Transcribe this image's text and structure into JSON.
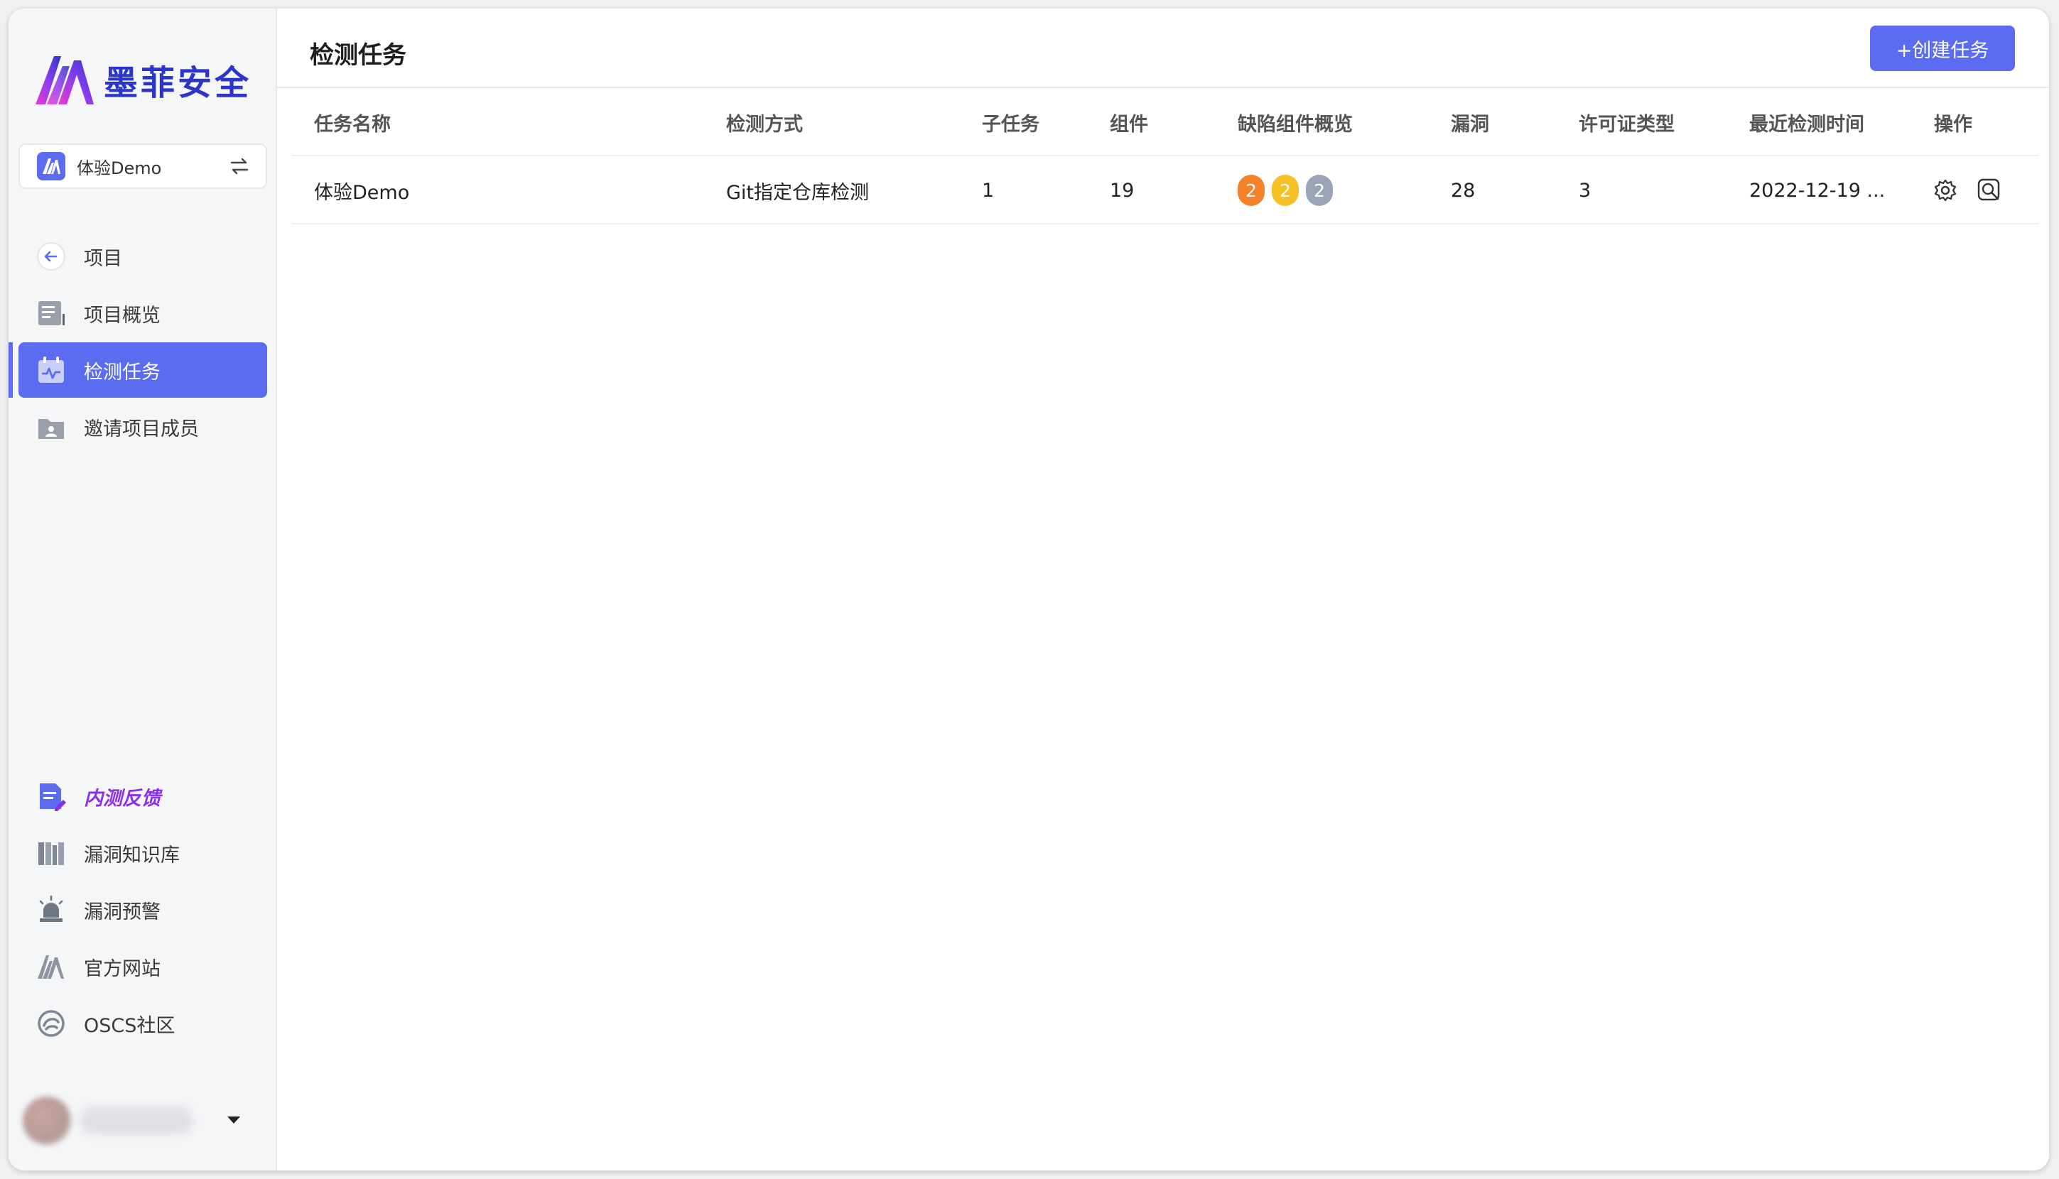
{
  "app": {
    "brand_name": "墨菲安全",
    "brand_color": "#2b35c9",
    "accent_color": "#5b6cf0"
  },
  "project_select": {
    "name": "体验Demo",
    "icon": "project-logo-icon",
    "switch_icon": "swap-icon"
  },
  "sidebar": {
    "items": [
      {
        "label": "项目",
        "icon": "back-arrow-icon",
        "active": false
      },
      {
        "label": "项目概览",
        "icon": "overview-icon",
        "active": false
      },
      {
        "label": "检测任务",
        "icon": "task-calendar-icon",
        "active": true
      },
      {
        "label": "邀请项目成员",
        "icon": "invite-member-icon",
        "active": false
      }
    ],
    "bottom_items": [
      {
        "label": "内测反馈",
        "icon": "feedback-icon",
        "style": "highlight"
      },
      {
        "label": "漏洞知识库",
        "icon": "knowledge-base-icon"
      },
      {
        "label": "漏洞预警",
        "icon": "alarm-icon"
      },
      {
        "label": "官方网站",
        "icon": "brand-logo-icon"
      },
      {
        "label": "OSCS社区",
        "icon": "community-icon"
      }
    ]
  },
  "header": {
    "title": "检测任务",
    "create_button": "+创建任务"
  },
  "table": {
    "columns": [
      "任务名称",
      "检测方式",
      "子任务",
      "组件",
      "缺陷组件概览",
      "漏洞",
      "许可证类型",
      "最近检测时间",
      "操作"
    ],
    "rows": [
      {
        "name": "体验Demo",
        "method": "Git指定仓库检测",
        "subtasks": "1",
        "components": "19",
        "defects": [
          {
            "count": "2",
            "color": "#f5822a"
          },
          {
            "count": "2",
            "color": "#f6c027"
          },
          {
            "count": "2",
            "color": "#9aa4b6"
          }
        ],
        "vulnerabilities": "28",
        "license_types": "3",
        "last_scan": "2022-12-19 ...",
        "actions": [
          "settings-icon",
          "scan-detail-icon"
        ]
      }
    ]
  }
}
